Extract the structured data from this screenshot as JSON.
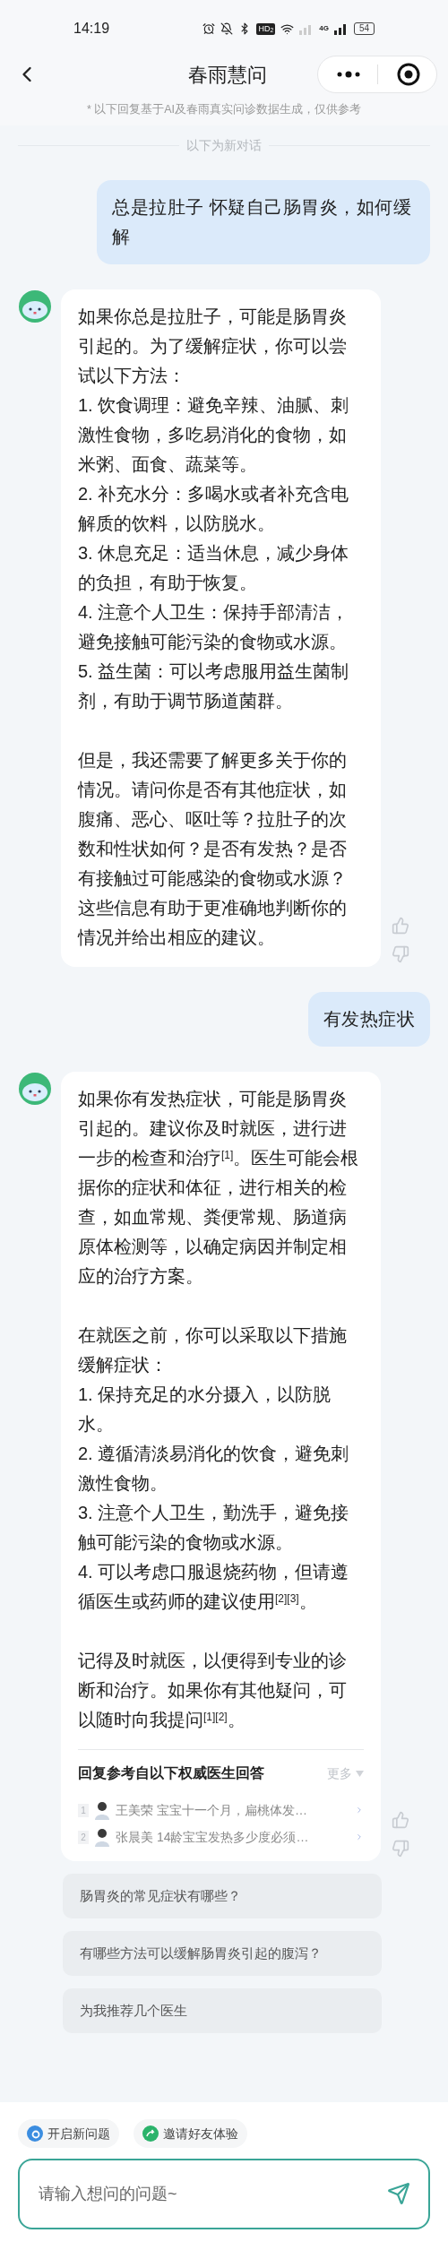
{
  "status_bar": {
    "time": "14:19",
    "hd_badge": "HD$_{2}$",
    "network": "4G",
    "battery": "54"
  },
  "nav": {
    "title": "春雨慧问"
  },
  "disclaimer": "* 以下回复基于AI及春雨真实问诊数据生成，仅供参考",
  "divider_label": "以下为新对话",
  "messages": [
    {
      "kind": "user",
      "sections": [
        [
          "总是拉肚子 怀疑自己肠胃炎，如何缓解"
        ]
      ]
    },
    {
      "kind": "assistant",
      "sections": [
        [
          "如果你总是拉肚子，可能是肠胃炎引起的。为了缓解症状，你可以尝试以下方法：",
          "1. 饮食调理：避免辛辣、油腻、刺激性食物，多吃易消化的食物，如米粥、面食、蔬菜等。",
          "2. 补充水分：多喝水或者补充含电解质的饮料，以防脱水。",
          "3. 休息充足：适当休息，减少身体的负担，有助于恢复。",
          "4. 注意个人卫生：保持手部清洁，避免接触可能污染的食物或水源。",
          "5. 益生菌：可以考虑服用益生菌制剂，有助于调节肠道菌群。"
        ],
        [
          "但是，我还需要了解更多关于你的情况。请问你是否有其他症状，如腹痛、恶心、呕吐等？拉肚子的次数和性状如何？是否有发热？是否有接触过可能感染的食物或水源？这些信息有助于更准确地判断你的情况并给出相应的建议。"
        ]
      ]
    },
    {
      "kind": "user",
      "sections": [
        [
          "有发热症状"
        ]
      ]
    },
    {
      "kind": "assistant",
      "sections": [
        [
          "如果你有发热症状，可能是肠胃炎引起的。建议你及时就医，进行进一步的检查和治疗$^{[1]}$。医生可能会根据你的症状和体征，进行相关的检查，如血常规、粪便常规、肠道病原体检测等，以确定病因并制定相应的治疗方案。"
        ],
        [
          "在就医之前，你可以采取以下措施缓解症状：",
          "1. 保持充足的水分摄入，以防脱水。",
          "2. 遵循清淡易消化的饮食，避免刺激性食物。",
          "3. 注意个人卫生，勤洗手，避免接触可能污染的食物或水源。",
          "4. 可以考虑口服退烧药物，但请遵循医生或药师的建议使用$^{[2][3]}$。"
        ],
        [
          "记得及时就医，以便得到专业的诊断和治疗。如果你有其他疑问，可以随时向我提问$^{[1][2]}$。"
        ]
      ],
      "references": {
        "title": "回复参考自以下权威医生回答",
        "more": "更多",
        "items": [
          {
            "index": "1",
            "text": "王美荣 宝宝十一个月，扁桃体发…"
          },
          {
            "index": "2",
            "text": "张晨美 14龄宝宝发热多少度必须…"
          }
        ]
      }
    }
  ],
  "suggestions": [
    "肠胃炎的常见症状有哪些？",
    "有哪些方法可以缓解肠胃炎引起的腹泻？",
    "为我推荐几个医生"
  ],
  "actions": [
    {
      "kind": "new",
      "label": "开启新问题"
    },
    {
      "kind": "invite",
      "label": "邀请好友体验"
    }
  ],
  "input": {
    "placeholder": "请输入想问的问题~"
  }
}
